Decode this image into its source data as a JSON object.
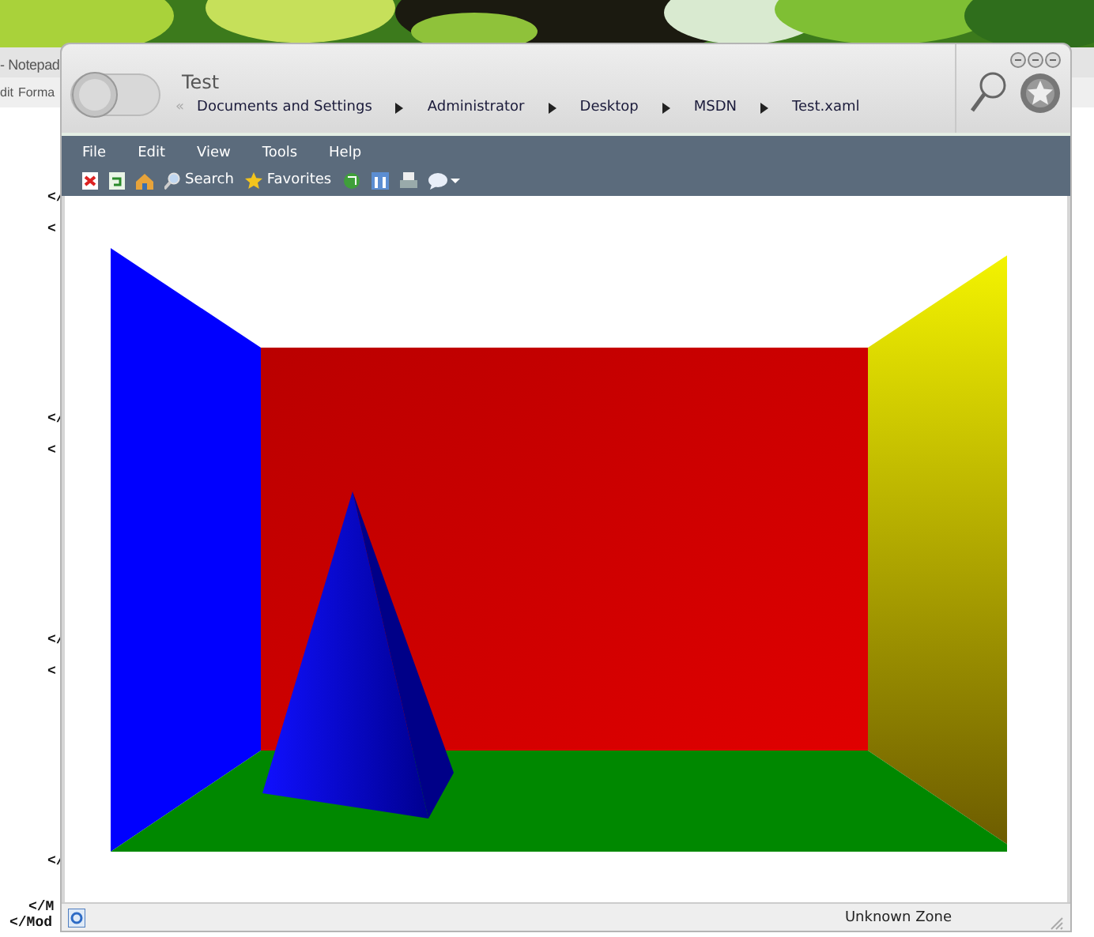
{
  "notepad": {
    "title": "- Notepad",
    "menu": [
      "dit",
      "Forma"
    ],
    "code_lines": [
      {
        "text": "</",
        "kind": "frag"
      },
      {
        "text": "<",
        "kind": "frag"
      },
      {
        "text": "</",
        "kind": "frag"
      },
      {
        "text": "<",
        "kind": "frag"
      },
      {
        "text": "</",
        "kind": "frag"
      },
      {
        "text": "<",
        "kind": "frag"
      },
      {
        "text": "</",
        "kind": "frag"
      },
      {
        "text": "</M",
        "kind": "end1"
      },
      {
        "text": "</Mod",
        "kind": "end2"
      }
    ]
  },
  "browser": {
    "title": "Test",
    "history_button": "«",
    "breadcrumbs": [
      "Documents and Settings",
      "Administrator",
      "Desktop",
      "MSDN",
      "Test.xaml"
    ],
    "menu": [
      "File",
      "Edit",
      "View",
      "Tools",
      "Help"
    ],
    "toolbar_labels": [
      "Search",
      "Favorites"
    ],
    "status_bar": {
      "zone": "Unknown Zone"
    }
  }
}
